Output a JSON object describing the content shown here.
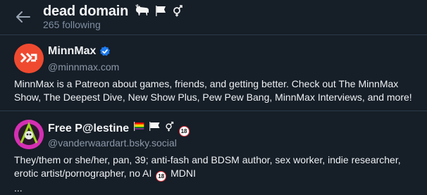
{
  "header": {
    "title": "dead domain",
    "title_emoji": "🐐🏳️⚧",
    "subtitle": "265 following"
  },
  "follows": [
    {
      "name": "MinnMax",
      "verified": true,
      "handle": "@minnmax.com",
      "bio_lines": [
        "MinnMax is a Patreon about games, friends, and getting better. Check out The MinnMax",
        "Show, The Deepest Dive, New Show Plus, Pew Pew Bang, MinnMax Interviews, and more!"
      ],
      "avatar_color": "#ef4a30"
    },
    {
      "name": "Free P@lestine",
      "name_emoji": "🏳️‍🌈🏳️⚧🔞",
      "handle": "@vanderwaardart.bsky.social",
      "bio_lines": [
        "They/them or she/her, pan, 39; anti-fash and BDSM author, sex worker, indie researcher,",
        "erotic artist/pornographer, no AI",
        "MDNI",
        "..."
      ],
      "badge_18": "18",
      "avatar_color": "#d52fb3"
    }
  ],
  "colors": {
    "background": "#161e27",
    "divider": "#2c3a4b",
    "muted_text": "#7f8fa3",
    "verified_blue": "#1d7bf0"
  }
}
